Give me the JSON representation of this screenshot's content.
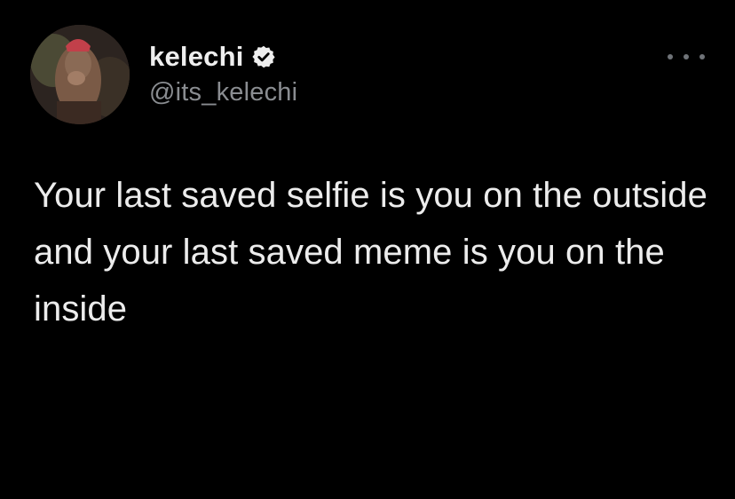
{
  "author": {
    "display_name": "kelechi",
    "handle": "@its_kelechi",
    "verified": true
  },
  "tweet": {
    "text": "Your last saved selfie is you on the outside and your last saved meme is you on the inside"
  },
  "icons": {
    "verified": "verified-badge-icon",
    "more": "more-options-icon"
  },
  "colors": {
    "background": "#000000",
    "text": "#ececec",
    "handle": "#8a8d91"
  }
}
